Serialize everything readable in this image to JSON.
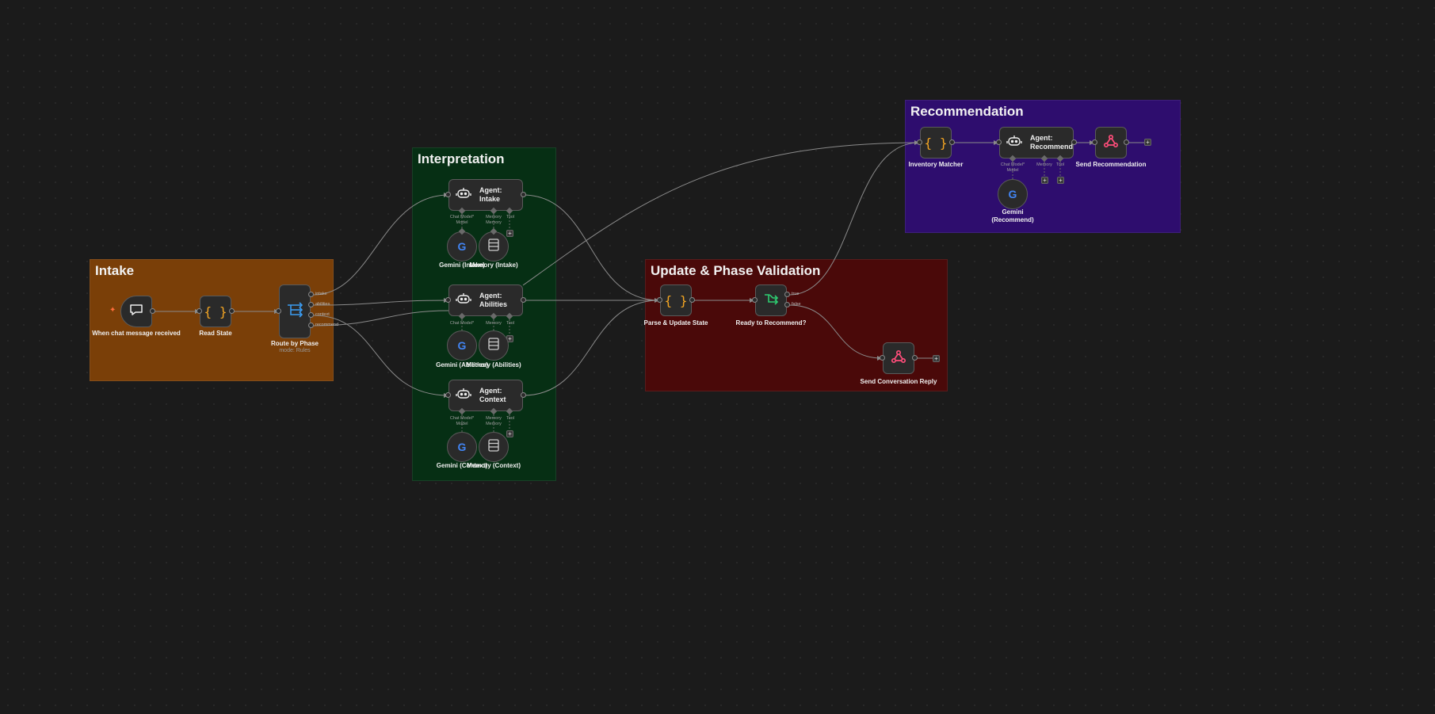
{
  "groups": {
    "intake": {
      "title": "Intake",
      "color": "#7a3f08"
    },
    "interpretation": {
      "title": "Interpretation",
      "color": "#062f14"
    },
    "update": {
      "title": "Update & Phase Validation",
      "color": "#4a0909"
    },
    "recommendation": {
      "title": "Recommendation",
      "color": "#2e0d6e"
    }
  },
  "nodes": {
    "chat_trigger": {
      "label": "When chat message received",
      "icon": "chat-bubble-icon"
    },
    "read_state": {
      "label": "Read State",
      "icon": "code-braces-icon"
    },
    "route": {
      "label": "Route by Phase",
      "sublabel": "mode: Rules",
      "icon": "switch-icon",
      "outputs": [
        "intake",
        "abilities",
        "context",
        "recommend"
      ]
    },
    "agent_intake": {
      "label": "Agent: Intake",
      "icon": "robot-icon"
    },
    "agent_abilities": {
      "label": "Agent: Abilities",
      "icon": "robot-icon"
    },
    "agent_context": {
      "label": "Agent: Context",
      "icon": "robot-icon"
    },
    "gemini_intake": {
      "label": "Gemini (Intake)",
      "icon": "google-icon"
    },
    "memory_intake": {
      "label": "Memory (Intake)",
      "icon": "database-icon"
    },
    "gemini_abilities": {
      "label": "Gemini (Abilities)",
      "icon": "google-icon"
    },
    "memory_abilities": {
      "label": "Memory (Abilities)",
      "icon": "database-icon"
    },
    "gemini_context": {
      "label": "Gemini (Context)",
      "icon": "google-icon"
    },
    "memory_context": {
      "label": "Memory (Context)",
      "icon": "database-icon"
    },
    "parse_update": {
      "label": "Parse & Update State",
      "icon": "code-braces-icon"
    },
    "ready": {
      "label": "Ready to Recommend?",
      "icon": "if-branch-icon",
      "outputs": [
        "true",
        "false"
      ]
    },
    "send_reply": {
      "label": "Send Conversation Reply",
      "icon": "webhook-icon"
    },
    "inventory": {
      "label": "Inventory Matcher",
      "icon": "code-braces-icon"
    },
    "agent_recommend": {
      "label": "Agent: Recommend",
      "icon": "robot-icon"
    },
    "send_recommendation": {
      "label": "Send Recommendation",
      "icon": "webhook-icon"
    },
    "gemini_recommend": {
      "label": "Gemini (Recommend)",
      "icon": "google-icon"
    }
  },
  "connectors": {
    "chat_model": "Chat Model*",
    "model": "Model",
    "memory": "Memory",
    "tool": "Tool"
  },
  "colors": {
    "trigger": "#ff6d3a",
    "code": "#f5a623",
    "switch": "#3b9bf0",
    "if": "#2ecc71",
    "webhook": "#ff4d7a",
    "edge": "#8a8a8a"
  }
}
